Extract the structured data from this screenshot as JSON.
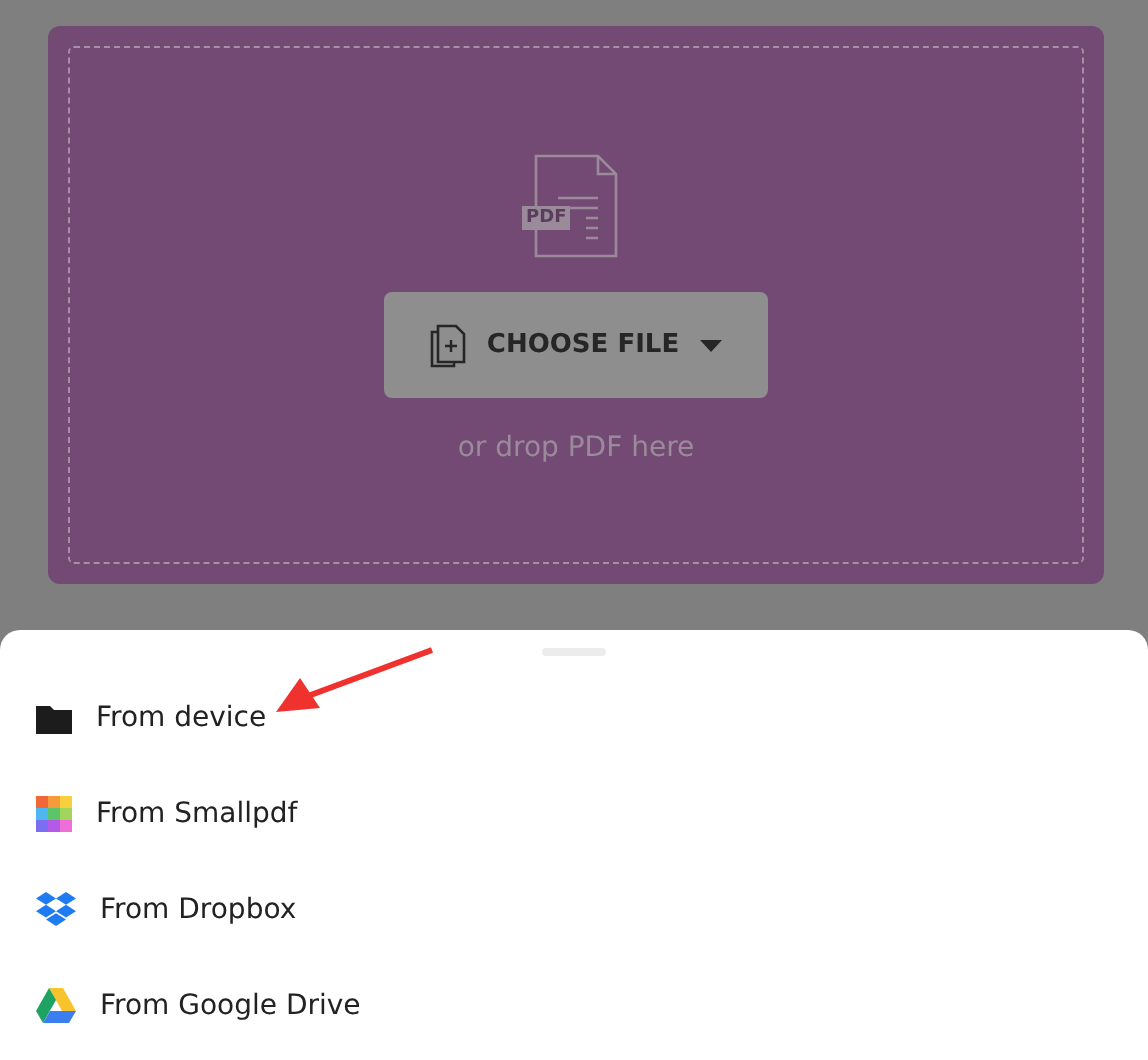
{
  "upload": {
    "file_badge": "PDF",
    "button": "CHOOSE FILE",
    "hint": "or drop PDF here"
  },
  "sources": [
    {
      "label": "From device"
    },
    {
      "label": "From Smallpdf"
    },
    {
      "label": "From Dropbox"
    },
    {
      "label": "From Google Drive"
    }
  ]
}
